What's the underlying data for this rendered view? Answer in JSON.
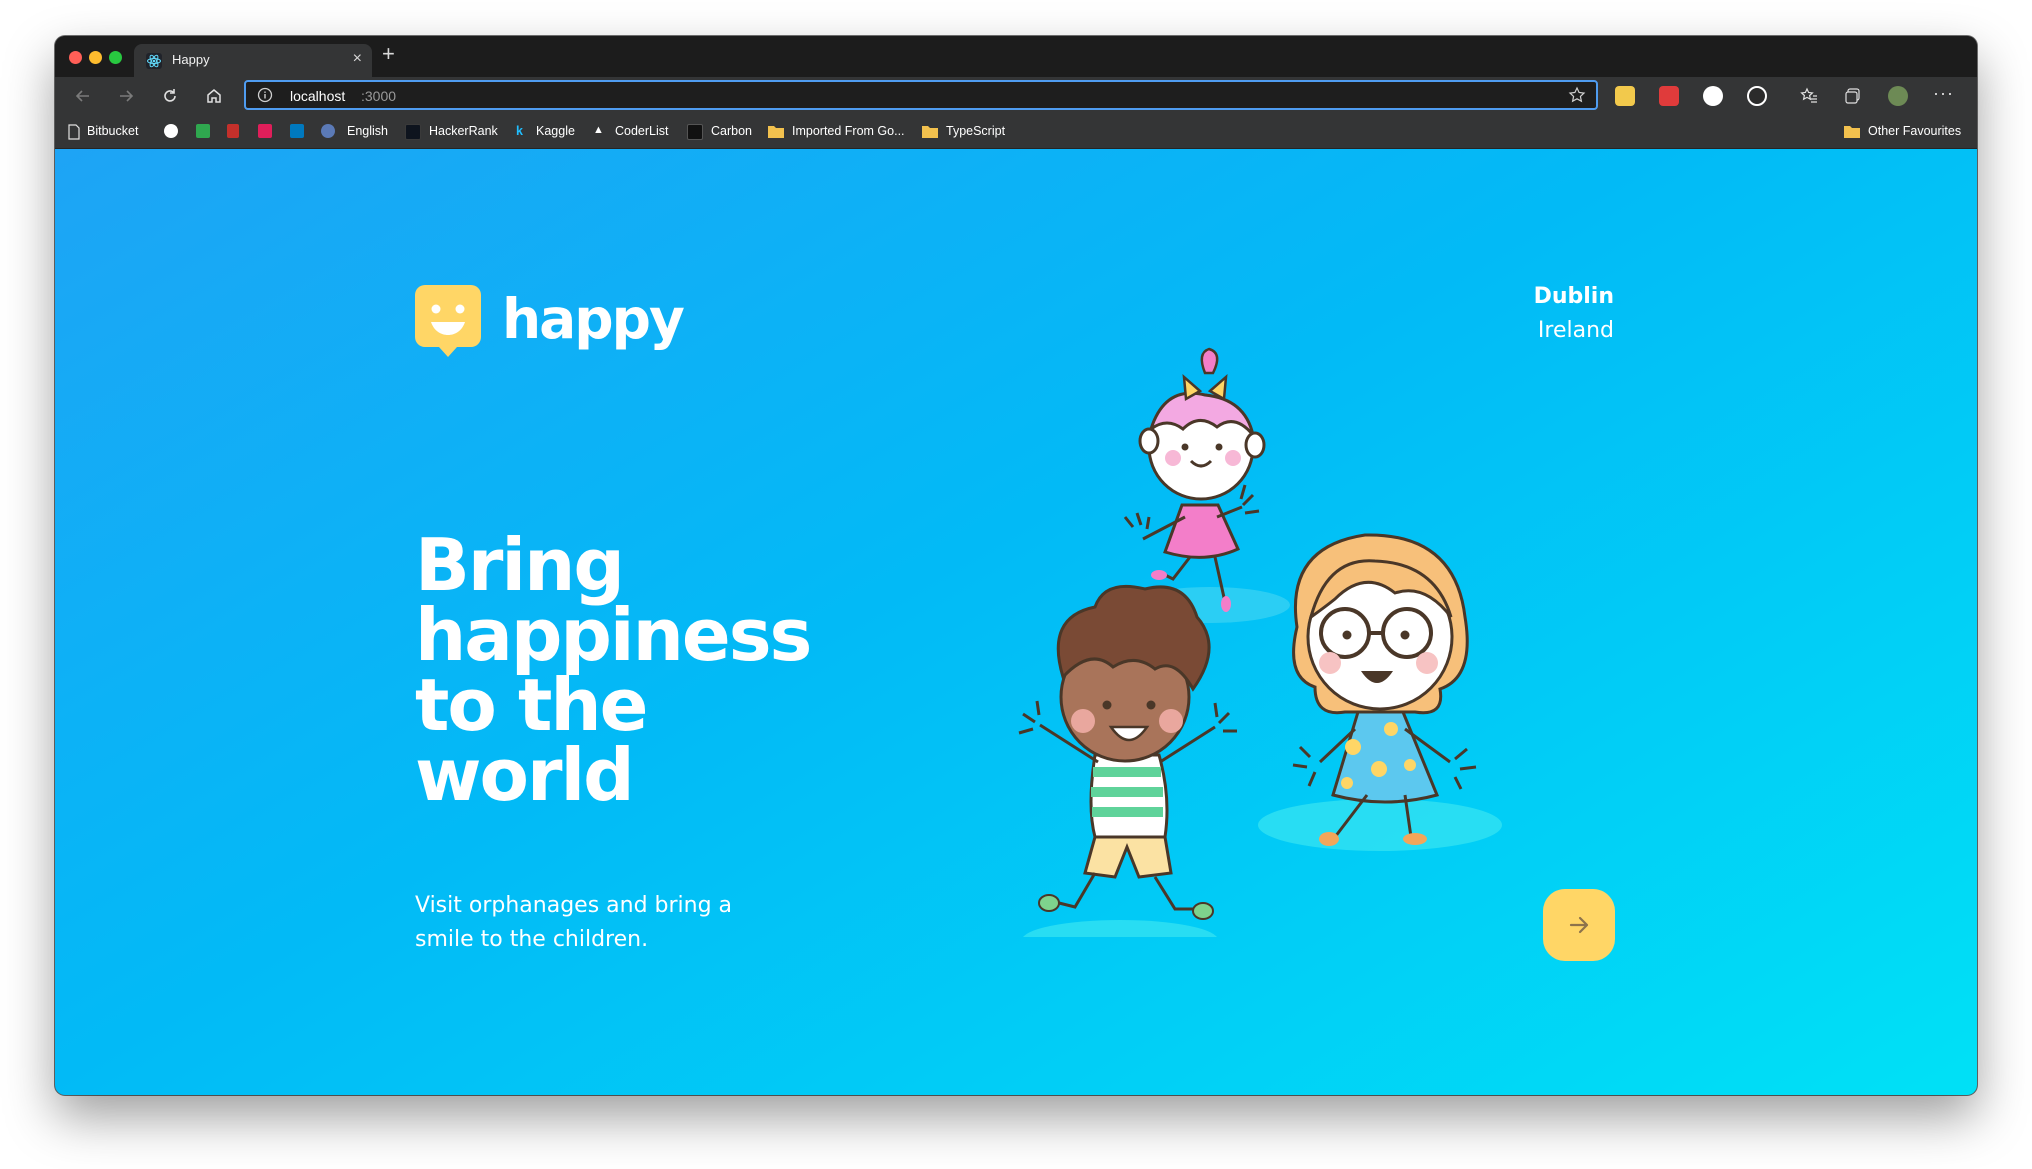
{
  "browser": {
    "tab": {
      "title": "Happy"
    },
    "address": {
      "host": "localhost",
      "port": ":3000"
    },
    "bookmarks": [
      {
        "label": "Bitbucket"
      },
      {
        "label": "English"
      },
      {
        "label": "HackerRank"
      },
      {
        "label": "Kaggle"
      },
      {
        "label": "CoderList"
      },
      {
        "label": "Carbon"
      },
      {
        "label": "Imported From Go..."
      },
      {
        "label": "TypeScript"
      }
    ],
    "other_favourites": "Other Favourites"
  },
  "page": {
    "logo_text": "happy",
    "location": {
      "city": "Dublin",
      "country": "Ireland"
    },
    "hero": {
      "line1": "Bring",
      "line2": "happiness",
      "line3": "to the",
      "line4": "world",
      "subtitle": "Visit orphanages and bring a smile to the children."
    },
    "colors": {
      "accent": "#FFD666",
      "logo": "#FFD666",
      "gradient_start": "#1EA4F5",
      "gradient_end": "#00E1F6"
    }
  }
}
